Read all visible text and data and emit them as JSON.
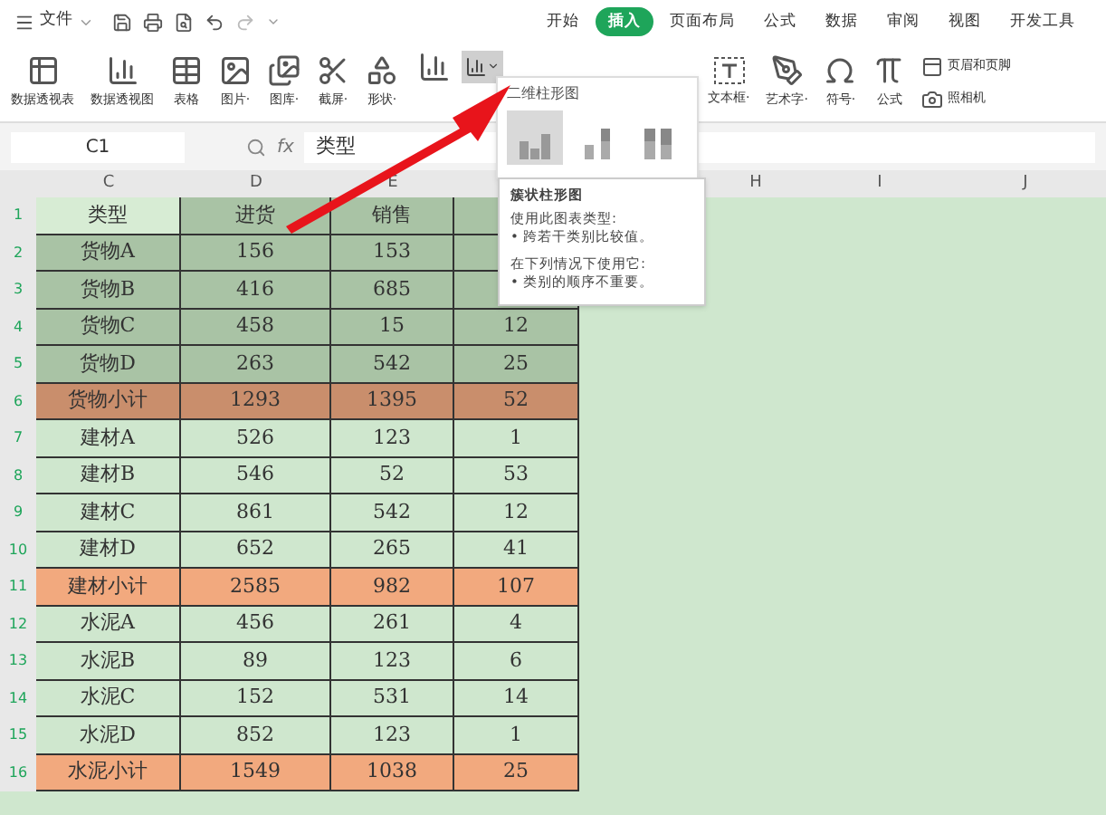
{
  "menu_bar": {
    "file_menu": "文件",
    "tabs": [
      {
        "label": "开始",
        "selected": false
      },
      {
        "label": "插入",
        "selected": true
      },
      {
        "label": "页面布局",
        "selected": false
      },
      {
        "label": "公式",
        "selected": false
      },
      {
        "label": "数据",
        "selected": false
      },
      {
        "label": "审阅",
        "selected": false
      },
      {
        "label": "视图",
        "selected": false
      },
      {
        "label": "开发工具",
        "selected": false
      }
    ]
  },
  "ribbon": {
    "left": [
      "数据透视表",
      "数据透视图",
      "表格",
      "图片·",
      "图库·",
      "截屏·",
      "形状·"
    ],
    "right": [
      "文本框·",
      "艺术字·",
      "符号·",
      "公式"
    ],
    "small": [
      "页眉和页脚",
      "照相机"
    ]
  },
  "formula_bar": {
    "cell_ref": "C1",
    "fx": "fx",
    "value": "类型"
  },
  "columns": [
    "C",
    "D",
    "E",
    "H",
    "I",
    "J"
  ],
  "rows": [
    {
      "number": "1",
      "kind": "header",
      "selected": true,
      "cells": [
        "类型",
        "进货",
        "销售"
      ]
    },
    {
      "number": "2",
      "kind": "item",
      "selected": true,
      "cells": [
        "货物A",
        "156",
        "153"
      ]
    },
    {
      "number": "3",
      "kind": "item",
      "selected": true,
      "cells": [
        "货物B",
        "416",
        "685"
      ]
    },
    {
      "number": "4",
      "kind": "item",
      "selected": true,
      "cells": [
        "货物C",
        "458",
        "15",
        "12"
      ]
    },
    {
      "number": "5",
      "kind": "item",
      "selected": true,
      "cells": [
        "货物D",
        "263",
        "542",
        "25"
      ]
    },
    {
      "number": "6",
      "kind": "subtotal",
      "selected": true,
      "cells": [
        "货物小计",
        "1293",
        "1395",
        "52"
      ]
    },
    {
      "number": "7",
      "kind": "item",
      "selected": false,
      "cells": [
        "建材A",
        "526",
        "123",
        "1"
      ]
    },
    {
      "number": "8",
      "kind": "item",
      "selected": false,
      "cells": [
        "建材B",
        "546",
        "52",
        "53"
      ]
    },
    {
      "number": "9",
      "kind": "item",
      "selected": false,
      "cells": [
        "建材C",
        "861",
        "542",
        "12"
      ]
    },
    {
      "number": "10",
      "kind": "item",
      "selected": false,
      "cells": [
        "建材D",
        "652",
        "265",
        "41"
      ]
    },
    {
      "number": "11",
      "kind": "subtotal",
      "selected": false,
      "cells": [
        "建材小计",
        "2585",
        "982",
        "107"
      ]
    },
    {
      "number": "12",
      "kind": "item",
      "selected": false,
      "cells": [
        "水泥A",
        "456",
        "261",
        "4"
      ]
    },
    {
      "number": "13",
      "kind": "item",
      "selected": false,
      "cells": [
        "水泥B",
        "89",
        "123",
        "6"
      ]
    },
    {
      "number": "14",
      "kind": "item",
      "selected": false,
      "cells": [
        "水泥C",
        "152",
        "531",
        "14"
      ]
    },
    {
      "number": "15",
      "kind": "item",
      "selected": false,
      "cells": [
        "水泥D",
        "852",
        "123",
        "1"
      ]
    },
    {
      "number": "16",
      "kind": "subtotal",
      "selected": false,
      "cells": [
        "水泥小计",
        "1549",
        "1038",
        "25"
      ]
    }
  ],
  "chart_menu": {
    "title": "二维柱形图",
    "options": [
      {
        "selected": true
      },
      {
        "selected": false
      },
      {
        "selected": false
      }
    ]
  },
  "tooltip": {
    "title": "簇状柱形图",
    "lines": [
      "使用此图表类型:",
      "• 跨若干类别比较值。",
      "在下列情况下使用它:",
      "• 类别的顺序不重要。"
    ]
  }
}
